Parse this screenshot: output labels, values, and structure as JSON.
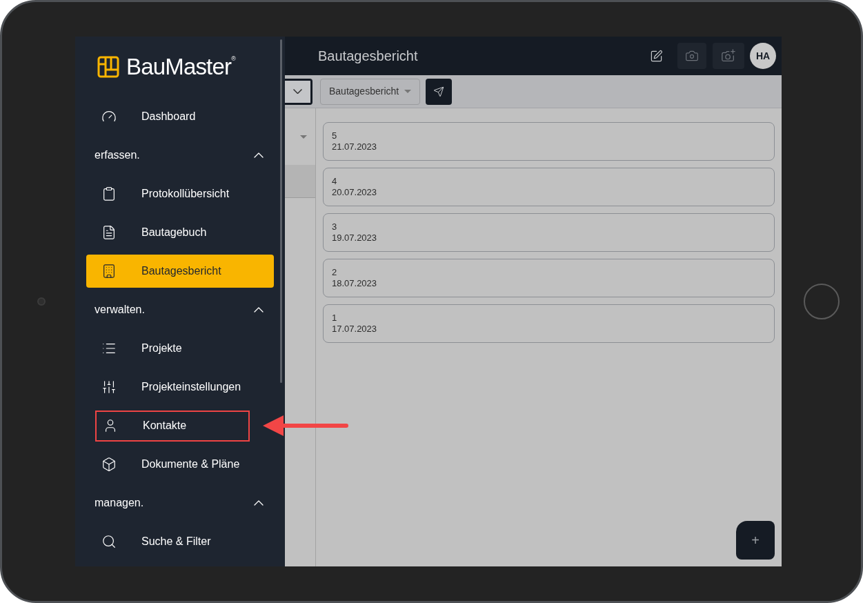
{
  "sidebar": {
    "logo": "BauMaster",
    "logo_mark": "®",
    "items": [
      {
        "kind": "link",
        "label": "Dashboard",
        "selected": false,
        "annotated": false
      },
      {
        "kind": "section",
        "label": "erfassen.",
        "expanded": true
      },
      {
        "kind": "link",
        "label": "Protokollübersicht",
        "selected": false,
        "annotated": false
      },
      {
        "kind": "link",
        "label": "Bautagebuch",
        "selected": false,
        "annotated": false
      },
      {
        "kind": "link",
        "label": "Bautagesbericht",
        "selected": true,
        "annotated": false
      },
      {
        "kind": "section",
        "label": "verwalten.",
        "expanded": true
      },
      {
        "kind": "link",
        "label": "Projekte",
        "selected": false,
        "annotated": false
      },
      {
        "kind": "link",
        "label": "Projekteinstellungen",
        "selected": false,
        "annotated": false
      },
      {
        "kind": "link",
        "label": "Kontakte",
        "selected": false,
        "annotated": true
      },
      {
        "kind": "link",
        "label": "Dokumente & Pläne",
        "selected": false,
        "annotated": false
      },
      {
        "kind": "section",
        "label": "managen.",
        "expanded": true
      },
      {
        "kind": "link",
        "label": "Suche & Filter",
        "selected": false,
        "annotated": false
      }
    ]
  },
  "header": {
    "title": "Bautagesbericht",
    "avatar": "HA"
  },
  "toolbar": {
    "report_select": "Bautagesbericht"
  },
  "reports": [
    {
      "number": "5",
      "date": "21.07.2023"
    },
    {
      "number": "4",
      "date": "20.07.2023"
    },
    {
      "number": "3",
      "date": "19.07.2023"
    },
    {
      "number": "2",
      "date": "18.07.2023"
    },
    {
      "number": "1",
      "date": "17.07.2023"
    }
  ],
  "fab": {
    "label": "+"
  }
}
